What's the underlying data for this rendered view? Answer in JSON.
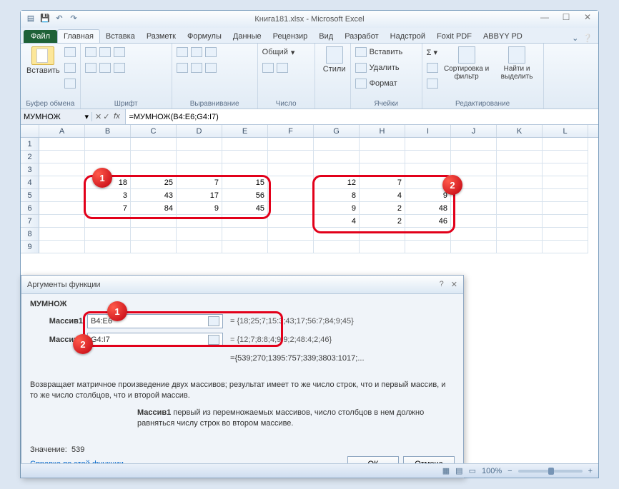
{
  "window": {
    "title": "Книга181.xlsx - Microsoft Excel"
  },
  "ribbon": {
    "file": "Файл",
    "tabs": [
      "Главная",
      "Вставка",
      "Разметк",
      "Формулы",
      "Данные",
      "Рецензир",
      "Вид",
      "Разработ",
      "Надстрой",
      "Foxit PDF",
      "ABBYY PD"
    ],
    "active_tab": 0,
    "groups": {
      "clipboard": {
        "label": "Буфер обмена",
        "paste": "Вставить"
      },
      "font": {
        "label": "Шрифт"
      },
      "align": {
        "label": "Выравнивание"
      },
      "number": {
        "label": "Число",
        "format": "Общий"
      },
      "styles": {
        "label": "",
        "btn": "Стили"
      },
      "cells": {
        "label": "Ячейки",
        "insert": "Вставить",
        "delete": "Удалить",
        "format": "Формат"
      },
      "editing": {
        "label": "Редактирование",
        "sort": "Сортировка и фильтр",
        "find": "Найти и выделить"
      }
    }
  },
  "formula_bar": {
    "cell_ref": "МУМНОЖ",
    "formula": "=МУМНОЖ(B4:E6;G4:I7)"
  },
  "columns": [
    "A",
    "B",
    "C",
    "D",
    "E",
    "F",
    "G",
    "H",
    "I",
    "J",
    "K",
    "L"
  ],
  "sheet": {
    "B4": 18,
    "C4": 25,
    "D4": 7,
    "E4": 15,
    "B5": 3,
    "C5": 43,
    "D5": 17,
    "E5": 56,
    "B6": 7,
    "C6": 84,
    "D6": 9,
    "E6": 45,
    "G4": 12,
    "H4": 7,
    "I4": 8,
    "G5": 8,
    "H5": 4,
    "I5": 9,
    "G6": 9,
    "H6": 2,
    "I6": 48,
    "G7": 4,
    "H7": 2,
    "I7": 46
  },
  "dialog": {
    "title": "Аргументы функции",
    "fn": "МУМНОЖ",
    "args": [
      {
        "label": "Массив1",
        "value": "B4:E6",
        "preview": "{18;25;7;15:3;43;17;56:7;84;9;45}"
      },
      {
        "label": "Массив2",
        "value": "G4:I7",
        "preview": "{12;7;8:8;4;9:9;2;48:4;2;46}"
      }
    ],
    "result_preview": "{539;270;1395:757;339;3803:1017;...",
    "description": "Возвращает матричное произведение двух массивов; результат имеет то же число строк, что и первый массив, и то же число столбцов, что и второй массив.",
    "arg_desc_label": "Массив1",
    "arg_desc": "первый из перемножаемых массивов, число столбцов в нем должно равняться числу строк во втором массиве.",
    "value_label": "Значение:",
    "value": "539",
    "help": "Справка по этой функции",
    "ok": "ОК",
    "cancel": "Отмена"
  },
  "status": {
    "zoom": "100%"
  },
  "chart_data": {
    "type": "table",
    "matrix1": {
      "range": "B4:E6",
      "rows": [
        [
          18,
          25,
          7,
          15
        ],
        [
          3,
          43,
          17,
          56
        ],
        [
          7,
          84,
          9,
          45
        ]
      ]
    },
    "matrix2": {
      "range": "G4:I7",
      "rows": [
        [
          12,
          7,
          8
        ],
        [
          8,
          4,
          9
        ],
        [
          9,
          2,
          48
        ],
        [
          4,
          2,
          46
        ]
      ]
    },
    "function": "МУМНОЖ",
    "result_first": 539
  }
}
